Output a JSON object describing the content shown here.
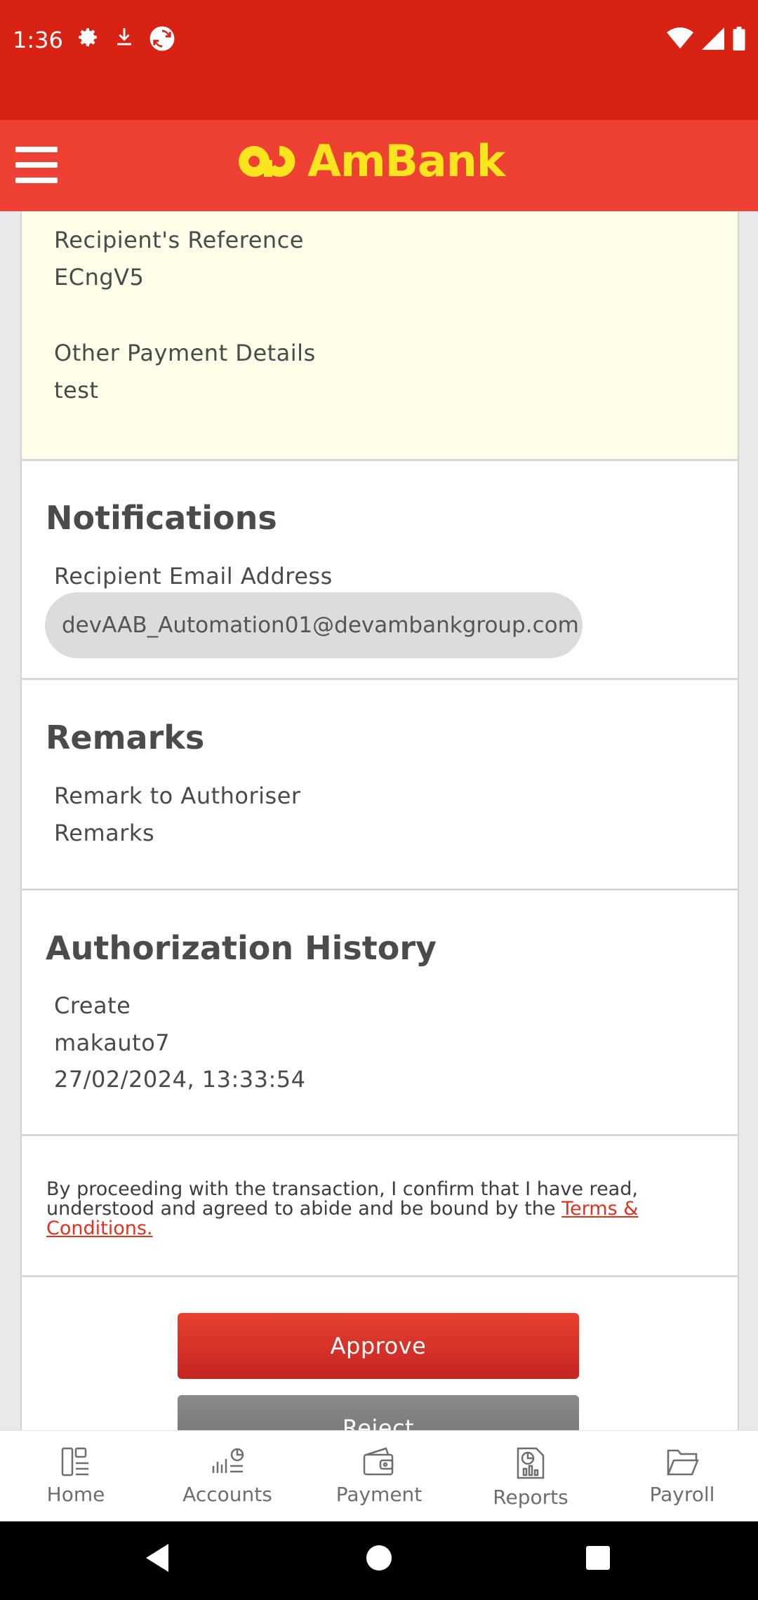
{
  "status_bar": {
    "time": "1:36",
    "left_icons": [
      "settings-icon",
      "download-icon",
      "sync-icon"
    ],
    "right_icons": [
      "wifi-icon",
      "signal-icon",
      "battery-icon"
    ],
    "color": "#d82214"
  },
  "header": {
    "brand": "AmBank",
    "brand_color": "#fce51f",
    "background": "#ee4133"
  },
  "reference_details": {
    "recipient_reference_label": "Recipient's Reference",
    "recipient_reference_value": "ECngV5",
    "other_payment_label": "Other Payment Details",
    "other_payment_value": "test"
  },
  "notifications": {
    "title": "Notifications",
    "email_label": "Recipient Email Address",
    "email_value": "devAAB_Automation01@devambankgroup.com"
  },
  "remarks": {
    "title": "Remarks",
    "label": "Remark to Authoriser",
    "value": "Remarks"
  },
  "auth_history": {
    "title": "Authorization History",
    "action": "Create",
    "user": "makauto7",
    "datetime": "27/02/2024, 13:33:54"
  },
  "terms": {
    "text": "By proceeding with the transaction, I confirm that I have read, understood and agreed to abide and be bound by the",
    "link": "Terms & Conditions."
  },
  "actions": {
    "approve": "Approve",
    "reject": "Reject"
  },
  "bottom_nav": {
    "items": [
      {
        "label": "Home",
        "icon": "home-icon"
      },
      {
        "label": "Accounts",
        "icon": "accounts-icon"
      },
      {
        "label": "Payment",
        "icon": "wallet-icon"
      },
      {
        "label": "Reports",
        "icon": "reports-icon"
      },
      {
        "label": "Payroll",
        "icon": "folder-icon"
      }
    ]
  }
}
